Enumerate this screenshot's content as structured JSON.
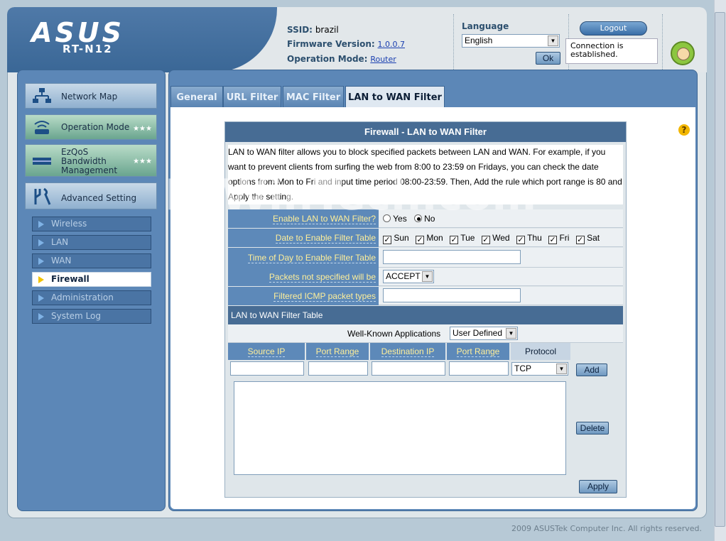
{
  "header": {
    "logo_text": "ASUS",
    "model": "RT-N12",
    "ssid_label": "SSID:",
    "ssid_value": "brazil",
    "firmware_label": "Firmware Version:",
    "firmware_value": "1.0.0.7",
    "opmode_label": "Operation Mode:",
    "opmode_value": "Router",
    "language_label": "Language",
    "language_value": "English",
    "ok_label": "Ok",
    "logout_label": "Logout",
    "status_text": "Connection is established."
  },
  "sidebar": {
    "main_items": [
      {
        "label": "Network Map"
      },
      {
        "label": "Operation Mode"
      },
      {
        "label": "EzQoS Bandwidth Management"
      },
      {
        "label": "Advanced Setting"
      }
    ],
    "sub_items": [
      {
        "label": "Wireless"
      },
      {
        "label": "LAN"
      },
      {
        "label": "WAN"
      },
      {
        "label": "Firewall"
      },
      {
        "label": "Administration"
      },
      {
        "label": "System Log"
      }
    ]
  },
  "tabs": [
    {
      "label": "General"
    },
    {
      "label": "URL Filter"
    },
    {
      "label": "MAC Filter"
    },
    {
      "label": "LAN to WAN Filter"
    }
  ],
  "panel": {
    "title": "Firewall - LAN to WAN Filter",
    "description": "LAN to WAN filter allows you to block specified packets between LAN and WAN. For example, if you want to prevent clients from surfing the web from 8:00 to 23:59 on Fridays, you can check the date options from Mon to Fri and input time period 08:00-23:59. Then, Add the rule which port range is 80 and Apply the setting.",
    "enable_label": "Enable LAN to WAN Filter?",
    "yes_label": "Yes",
    "no_label": "No",
    "date_label": "Date to Enable Filter Table",
    "days": [
      "Sun",
      "Mon",
      "Tue",
      "Wed",
      "Thu",
      "Fri",
      "Sat"
    ],
    "time_label": "Time of Day to Enable Filter Table",
    "packets_label": "Packets not specified will be",
    "packets_value": "ACCEPT",
    "icmp_label": "Filtered ICMP packet types",
    "table_head": "LAN to WAN Filter Table",
    "wellknown_label": "Well-Known Applications",
    "wellknown_value": "User Defined",
    "col_source_ip": "Source IP",
    "col_port_range": "Port Range",
    "col_dest_ip": "Destination IP",
    "col_port_range2": "Port Range",
    "col_protocol": "Protocol",
    "protocol_value": "TCP",
    "add_label": "Add",
    "delete_label": "Delete",
    "apply_label": "Apply"
  },
  "watermark": "PcWinTech.com",
  "footer": "2009 ASUSTek Computer Inc. All rights reserved."
}
